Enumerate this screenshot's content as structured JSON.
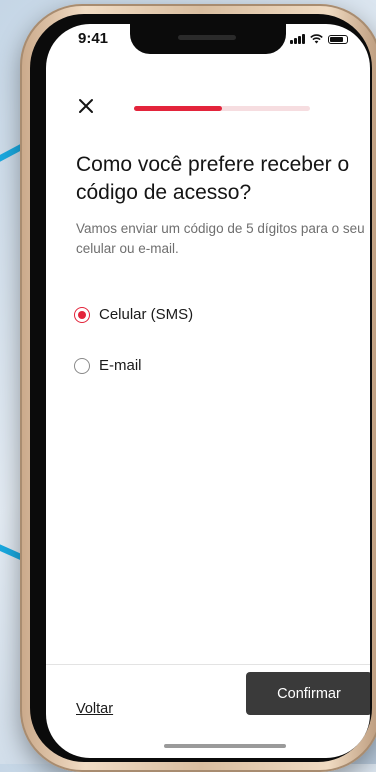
{
  "status_bar": {
    "time": "9:41"
  },
  "progress": {
    "fraction": 0.5,
    "fill_color": "#e3243b",
    "track_color": "#f6dde0"
  },
  "header": {
    "close_icon": "close-icon"
  },
  "title": "Como você prefere receber o código de acesso?",
  "subtitle": "Vamos enviar um código de 5 dígitos para o seu celular ou e-mail.",
  "options": [
    {
      "label": "Celular (SMS)",
      "selected": true
    },
    {
      "label": "E-mail",
      "selected": false
    }
  ],
  "footer": {
    "back_label": "Voltar",
    "confirm_label": "Confirmar"
  },
  "colors": {
    "accent": "#e3243b",
    "button": "#3a3a3a"
  }
}
